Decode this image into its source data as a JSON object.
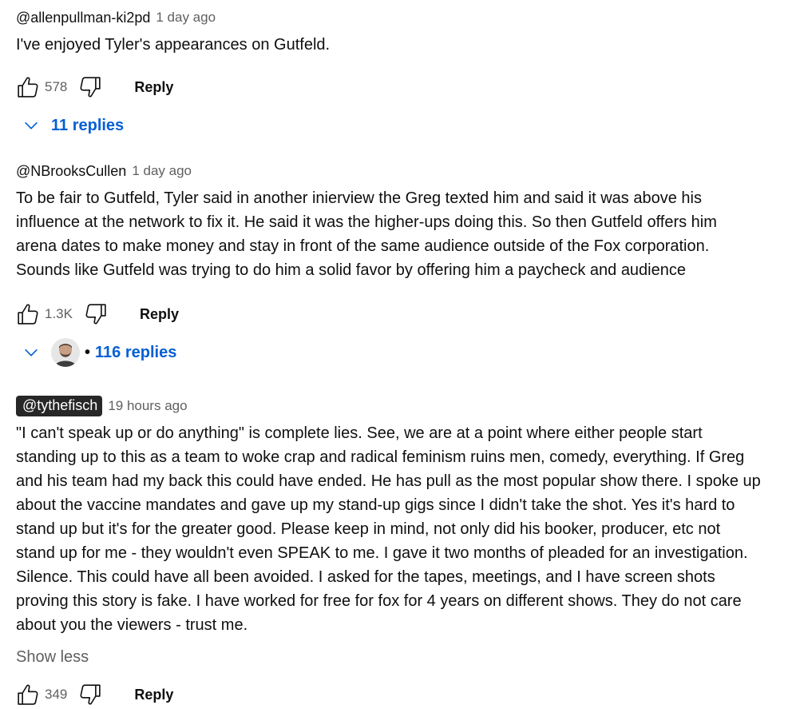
{
  "comments": [
    {
      "author": "@allenpullman-ki2pd",
      "time": "1 day ago",
      "text": "I've enjoyed Tyler's appearances on Gutfeld.",
      "likes": "578",
      "reply_label": "Reply",
      "replies_label": "11 replies"
    },
    {
      "author": "@NBrooksCullen",
      "time": "1 day ago",
      "text": "To be fair to Gutfeld, Tyler said in another inierview the Greg texted him and said it was above his\ninfluence at the network to fix it. He said it was the higher-ups doing this. So then Gutfeld offers him\narena dates to make money and stay in front of the same audience outside of the Fox corporation.\nSounds like Gutfeld was trying to do him a solid favor by offering him a paycheck and audience",
      "likes": "1.3K",
      "reply_label": "Reply",
      "replies_label": "116 replies",
      "replies_separator": "•"
    },
    {
      "author": "@tythefisch",
      "time": "19 hours ago",
      "text": "\"I can't speak up or do anything\" is complete lies. See, we are at a point where either people start\nstanding up to this as a team to woke crap and radical feminism ruins men, comedy, everything. If Greg\nand his team had my back this could have ended. He has pull as the most popular show there. I spoke up\nabout the vaccine mandates and gave up my stand-up gigs since I didn't take the shot. Yes it's hard to\nstand up but it's for the greater good. Please keep in mind, not only did his booker, producer, etc not\nstand up for me - they wouldn't even SPEAK to me. I gave it two months of pleaded for an investigation.\nSilence. This could have all been avoided. I asked for the tapes, meetings, and I have screen shots\nproving this story is fake. I have worked for free for fox for 4 years on different shows. They do not care\nabout you the viewers - trust me.",
      "show_less": "Show less",
      "likes": "349",
      "reply_label": "Reply"
    }
  ],
  "icons": {
    "like": "thumbs-up-icon",
    "dislike": "thumbs-down-icon",
    "expand": "chevron-down-icon"
  },
  "colors": {
    "link_blue": "#065fd4",
    "secondary_text": "#606060",
    "highlight_bg": "#272727"
  }
}
